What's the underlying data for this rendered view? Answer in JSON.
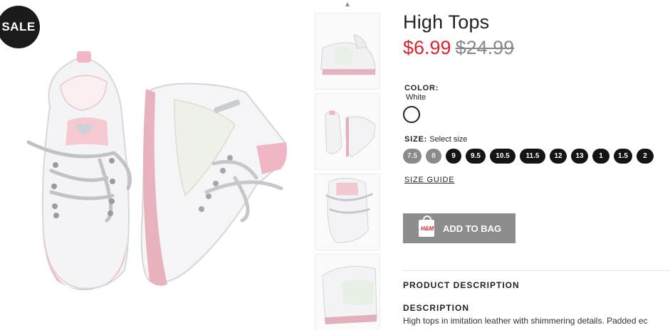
{
  "badge": {
    "label": "SALE"
  },
  "product": {
    "title": "High Tops",
    "price_sale": "$6.99",
    "price_original": "$24.99"
  },
  "color": {
    "label": "COLOR:",
    "value": "White",
    "swatch_color": "#ffffff"
  },
  "size": {
    "label": "SIZE:",
    "prompt": "Select size",
    "options": [
      {
        "label": "7.5",
        "available": false
      },
      {
        "label": "8",
        "available": false
      },
      {
        "label": "9",
        "available": true
      },
      {
        "label": "9.5",
        "available": true
      },
      {
        "label": "10.5",
        "available": true
      },
      {
        "label": "11.5",
        "available": true
      },
      {
        "label": "12",
        "available": true
      },
      {
        "label": "13",
        "available": true
      },
      {
        "label": "1",
        "available": true
      },
      {
        "label": "1.5",
        "available": true
      },
      {
        "label": "2",
        "available": true
      }
    ],
    "guide_label": "SIZE GUIDE"
  },
  "cart": {
    "add_label": "ADD TO BAG",
    "bag_brand": "H&M",
    "button_color": "#8c8c8c"
  },
  "details": {
    "product_description_label": "PRODUCT DESCRIPTION",
    "description_label": "DESCRIPTION",
    "description_text": "High tops in imitation leather with shimmering details. Padded ec"
  },
  "colors": {
    "sale_price": "#d8242c",
    "badge_bg": "#1b1b1b",
    "size_available": "#141414",
    "size_unavailable": "#8a8a8a"
  },
  "icons": [
    "chevron-up-icon",
    "shopping-bag-icon"
  ]
}
